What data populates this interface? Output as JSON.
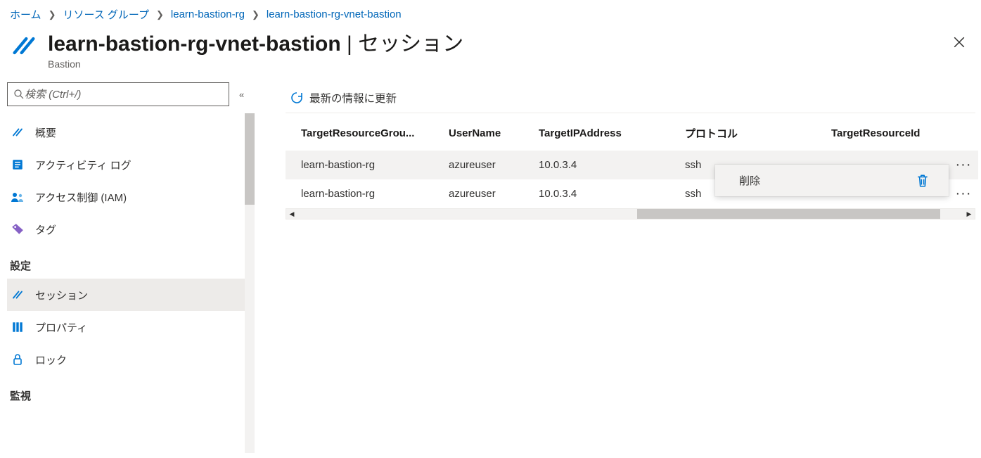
{
  "breadcrumb": {
    "items": [
      {
        "label": "ホーム"
      },
      {
        "label": "リソース グループ"
      },
      {
        "label": "learn-bastion-rg"
      },
      {
        "label": "learn-bastion-rg-vnet-bastion"
      }
    ]
  },
  "header": {
    "title": "learn-bastion-rg-vnet-bastion",
    "separator": " | ",
    "subtitle": "セッション",
    "resource_type": "Bastion"
  },
  "sidebar": {
    "search_placeholder": "検索 (Ctrl+/)",
    "items": [
      {
        "icon": "bastion",
        "label": "概要"
      },
      {
        "icon": "log",
        "label": "アクティビティ ログ"
      },
      {
        "icon": "iam",
        "label": "アクセス制御 (IAM)"
      },
      {
        "icon": "tag",
        "label": "タグ"
      }
    ],
    "groups": [
      {
        "heading": "設定",
        "items": [
          {
            "icon": "bastion",
            "label": "セッション",
            "active": true
          },
          {
            "icon": "properties",
            "label": "プロパティ"
          },
          {
            "icon": "lock",
            "label": "ロック"
          }
        ]
      },
      {
        "heading": "監視",
        "items": []
      }
    ]
  },
  "commands": {
    "refresh": "最新の情報に更新"
  },
  "grid": {
    "columns": [
      "TargetResourceGrou...",
      "UserName",
      "TargetIPAddress",
      "プロトコル",
      "TargetResourceId"
    ],
    "rows": [
      {
        "rg": "learn-bastion-rg",
        "user": "azureuser",
        "ip": "10.0.3.4",
        "proto": "ssh",
        "rid": ""
      },
      {
        "rg": "learn-bastion-rg",
        "user": "azureuser",
        "ip": "10.0.3.4",
        "proto": "ssh",
        "rid": ""
      }
    ]
  },
  "context_menu": {
    "delete": "削除"
  }
}
